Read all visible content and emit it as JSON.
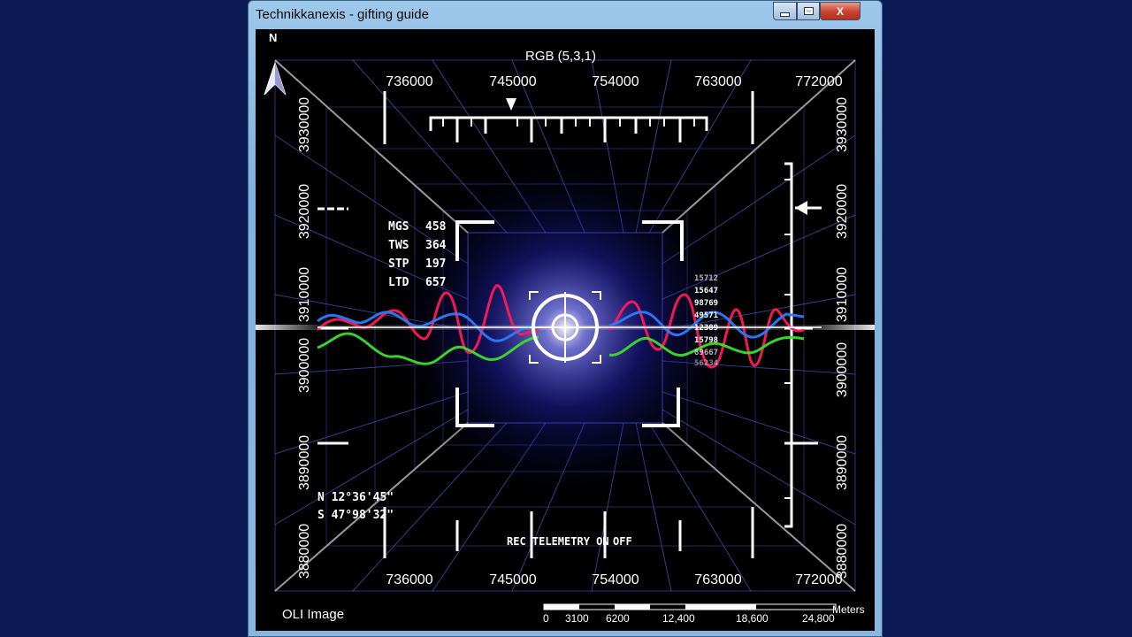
{
  "window": {
    "title": "Technikkanexis - gifting guide",
    "close_label": "X"
  },
  "display": {
    "north_label": "N",
    "rgb_label": "RGB (5,3,1)",
    "x_ticks_top": [
      "736000",
      "745000",
      "754000",
      "763000",
      "772000"
    ],
    "x_ticks_bottom": [
      "736000",
      "745000",
      "754000",
      "763000",
      "772000"
    ],
    "y_ticks_left": [
      "3930000",
      "3920000",
      "3910000",
      "3900000",
      "3890000",
      "3880000"
    ],
    "y_ticks_right": [
      "3930000",
      "3920000",
      "3910000",
      "3900000",
      "3890000",
      "3880000"
    ],
    "stats": [
      {
        "label": "MGS",
        "value": "458"
      },
      {
        "label": "TWS",
        "value": "364"
      },
      {
        "label": "STP",
        "value": "197"
      },
      {
        "label": "LTD",
        "value": "657"
      }
    ],
    "side_numbers": [
      "15712",
      "15647",
      "98769",
      "49571",
      "12389",
      "15798",
      "89667",
      "56234"
    ],
    "coord_n": "N 12°36'45\"",
    "coord_s": "S 47°98'32\"",
    "telemetry_label": "REC TELEMETRY ON",
    "telemetry_off": "OFF",
    "image_label": "OLI Image",
    "scale_unit": "Meters",
    "scale_ticks": [
      "0",
      "3100",
      "6200",
      "12,400",
      "18,600",
      "24,800"
    ]
  },
  "colors": {
    "background": "#0b1a52",
    "wave_red": "#ff1a55",
    "wave_blue": "#2a7bff",
    "wave_green": "#3ddc2a",
    "glow": "#3a3aff"
  }
}
